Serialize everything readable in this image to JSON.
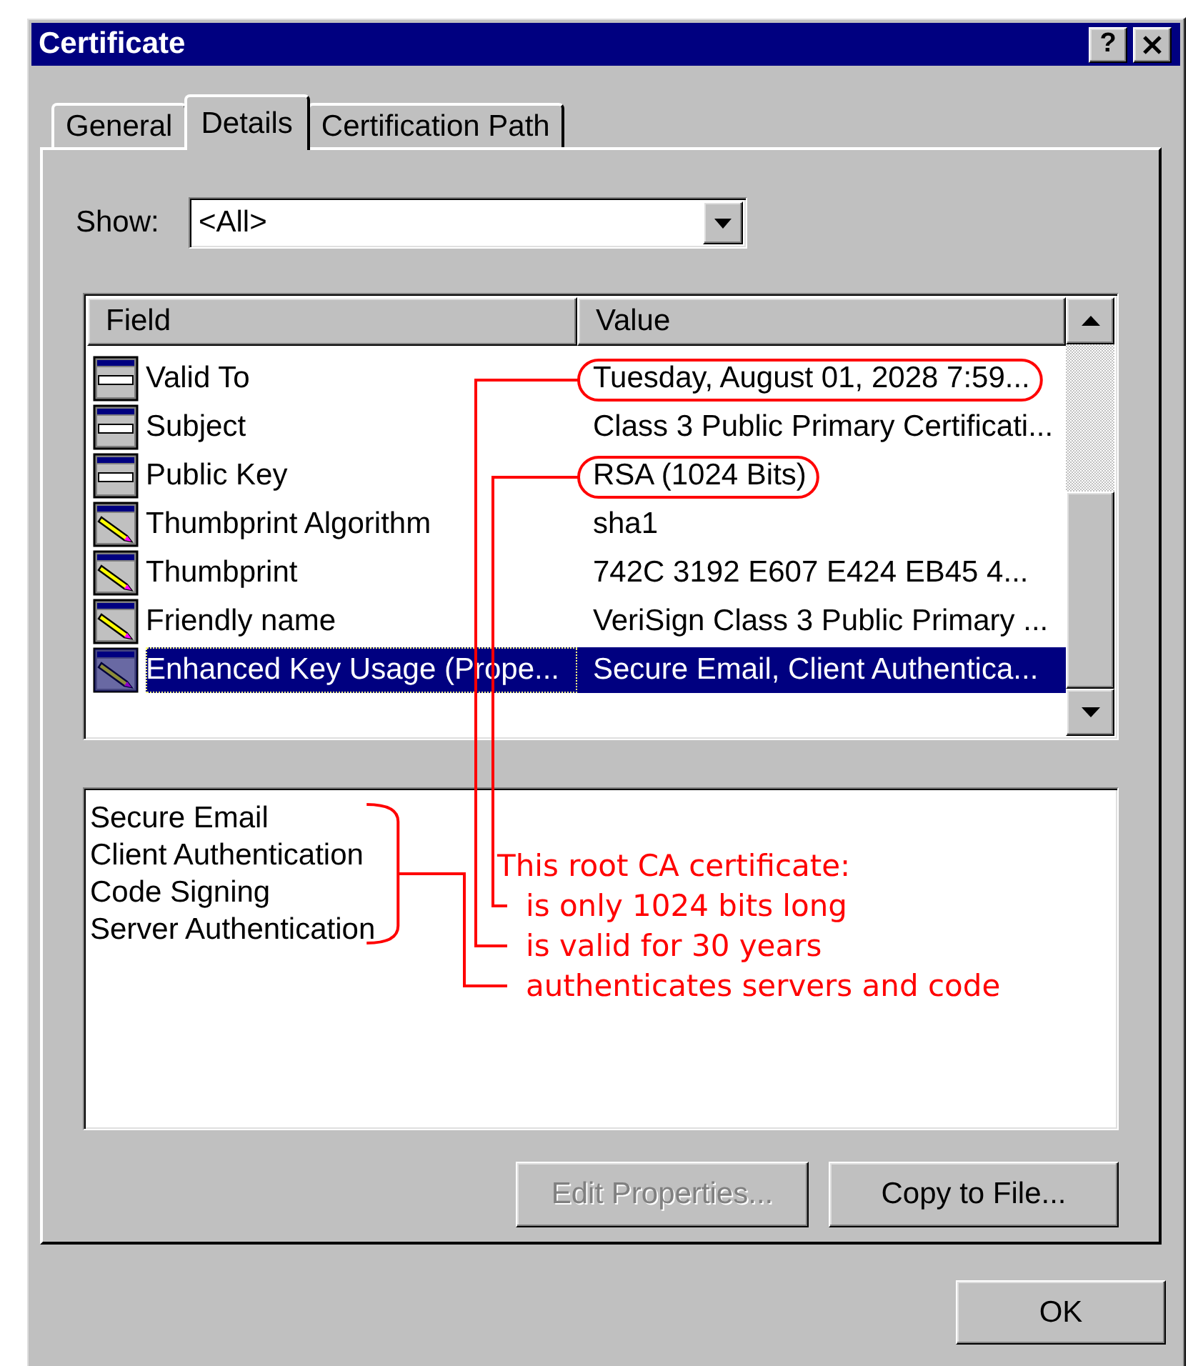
{
  "window": {
    "title": "Certificate",
    "help_button": "?"
  },
  "tabs": [
    {
      "label": "General",
      "selected": false
    },
    {
      "label": "Details",
      "selected": true
    },
    {
      "label": "Certification Path",
      "selected": false
    }
  ],
  "show": {
    "label": "Show:",
    "value": "<All>"
  },
  "fields": {
    "columns": [
      "Field",
      "Value"
    ],
    "rows": [
      {
        "kind": "property",
        "field": "Valid To",
        "value": "Tuesday, August 01, 2028 7:59...",
        "selected": false,
        "circled": true
      },
      {
        "kind": "property",
        "field": "Subject",
        "value": "Class 3 Public Primary Certificati...",
        "selected": false,
        "circled": false
      },
      {
        "kind": "property",
        "field": "Public Key",
        "value": "RSA (1024 Bits)",
        "selected": false,
        "circled": true
      },
      {
        "kind": "extension",
        "field": "Thumbprint Algorithm",
        "value": "sha1",
        "selected": false,
        "circled": false
      },
      {
        "kind": "extension",
        "field": "Thumbprint",
        "value": "742C 3192 E607 E424 EB45 4...",
        "selected": false,
        "circled": false
      },
      {
        "kind": "extension",
        "field": "Friendly name",
        "value": "VeriSign Class 3 Public Primary ...",
        "selected": false,
        "circled": false
      },
      {
        "kind": "extension",
        "field": "Enhanced Key Usage (Prope...",
        "value": "Secure Email, Client Authentica...",
        "selected": true,
        "circled": false
      }
    ]
  },
  "detail_lines": [
    "Secure Email",
    "Client Authentication",
    "Code Signing",
    "Server Authentication"
  ],
  "annotation": {
    "heading": "This root CA certificate:",
    "points": [
      "is only 1024 bits long",
      "is valid for 30 years",
      "authenticates servers and code"
    ]
  },
  "buttons": [
    {
      "label": "Edit Properties...",
      "disabled": true
    },
    {
      "label": "Copy to File...",
      "disabled": false
    }
  ],
  "ok_button": {
    "label": "OK"
  }
}
